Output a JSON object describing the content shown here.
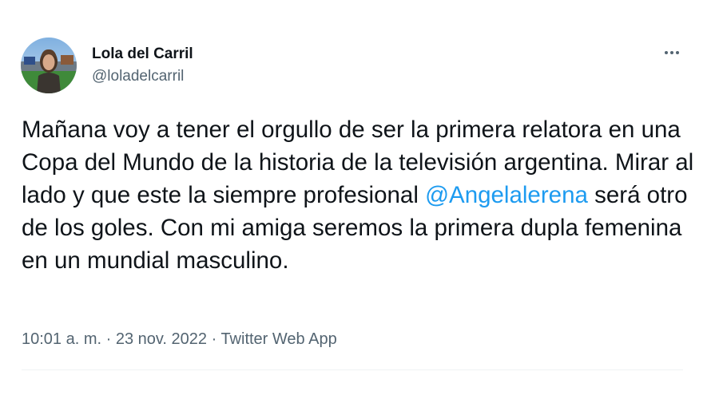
{
  "author": {
    "display_name": "Lola del Carril",
    "handle": "@loladelcarril",
    "avatar_icon": "profile-photo"
  },
  "more_icon": "ellipsis-icon",
  "tweet": {
    "text_before_mention": "Mañana voy a tener el orgullo de ser la primera relatora en una Copa del Mundo de la historia de la televisión argentina. Mirar al lado y que este la siempre profesional ",
    "mention": "@Angelalerena",
    "text_after_mention": " será otro de los goles. Con mi amiga seremos la primera dupla femenina en un mundial masculino."
  },
  "meta": {
    "time": "10:01 a. m.",
    "separator": " · ",
    "date": "23 nov. 2022",
    "source": "Twitter Web App"
  },
  "colors": {
    "text": "#0f1419",
    "secondary": "#536471",
    "link": "#1d9bf0",
    "divider": "#eff3f4"
  }
}
